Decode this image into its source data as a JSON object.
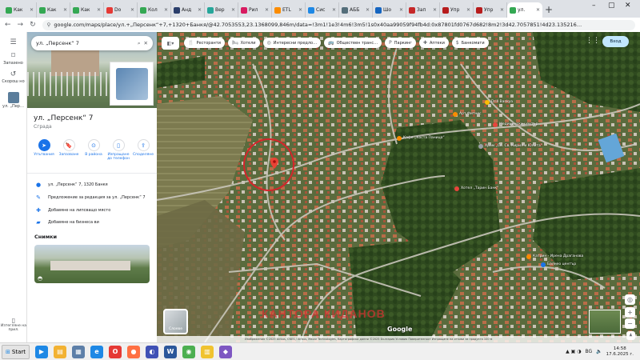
{
  "browser": {
    "tabs": [
      {
        "label": "Как",
        "color": "#34a853"
      },
      {
        "label": "Как",
        "color": "#34a853"
      },
      {
        "label": "Как",
        "color": "#34a853"
      },
      {
        "label": "Do",
        "color": "#e53935"
      },
      {
        "label": "Кол",
        "color": "#34a853"
      },
      {
        "label": "Анд",
        "color": "#2b3e6b"
      },
      {
        "label": "Вер",
        "color": "#26a69a"
      },
      {
        "label": "Рил",
        "color": "#d81b60"
      },
      {
        "label": "ETL",
        "color": "#fb8c00"
      },
      {
        "label": "Сис",
        "color": "#1e88e5"
      },
      {
        "label": "АББ",
        "color": "#546e7a"
      },
      {
        "label": "Шо",
        "color": "#1565c0"
      },
      {
        "label": "Зап",
        "color": "#c62828"
      },
      {
        "label": "Упр",
        "color": "#b71c1c"
      },
      {
        "label": "Упр",
        "color": "#b71c1c"
      }
    ],
    "active_tab": {
      "label": "ул.",
      "color": "#34a853"
    },
    "new_tab": "+",
    "url": "google.com/maps/place/ул.+„Персенк“+7,+1320+Банкя/@42.7053553,23.1368099,846m/data=!3m1!1e3!4m6!3m5!1s0x40aa99059f94fb4d:0x87801fd0767d682!8m2!3d42.7057851!4d23.135216…",
    "window_controls": [
      "–",
      "▢",
      "✕"
    ]
  },
  "rail": {
    "menu_icon": "☰",
    "saved": "Запазено",
    "recent": "Скорош но",
    "current": "ул. „Пер…",
    "bottom": "Изтегляне на прил."
  },
  "panel": {
    "search_value": "ул. „Персенк“ 7",
    "title": "ул. „Персенк“ 7",
    "subtitle": "Сграда",
    "actions": [
      {
        "label": "Упътвания",
        "icon": "➤",
        "primary": true
      },
      {
        "label": "Запазване",
        "icon": "🔖",
        "primary": false
      },
      {
        "label": "В района",
        "icon": "⊙",
        "primary": false
      },
      {
        "label": "Изпращане до телефон",
        "icon": "▯",
        "primary": false
      },
      {
        "label": "Споделяне",
        "icon": "⇪",
        "primary": false
      }
    ],
    "info": [
      {
        "icon": "●",
        "text": "ул. „Персенк“ 7, 1320 Банкя"
      },
      {
        "icon": "✎",
        "text": "Предложение за редакция за ул. „Персенк“ 7"
      },
      {
        "icon": "✚",
        "text": "Добавяне на липсващо място"
      },
      {
        "icon": "▰",
        "text": "Добавяне на бизнеса ви"
      }
    ],
    "photos_label": "Снимки"
  },
  "map": {
    "chips": [
      {
        "icon": "🍴",
        "label": "Ресторанти"
      },
      {
        "icon": "🛏",
        "label": "Хотели"
      },
      {
        "icon": "◎",
        "label": "Интересни предло…"
      },
      {
        "icon": "🚌",
        "label": "Обществен транс…"
      },
      {
        "icon": "P",
        "label": "Паркинг"
      },
      {
        "icon": "✚",
        "label": "Аптеки"
      },
      {
        "icon": "$",
        "label": "Банкомати"
      }
    ],
    "signin": "Вход",
    "pois": [
      {
        "name": "Drill Bankya",
        "color": "#fbbc04"
      },
      {
        "name": "Медицински център",
        "color": "#e8453c"
      },
      {
        "name": "Арт Фитнес",
        "color": "#fb8c00"
      },
      {
        "name": "Кафе „Коста Паница“",
        "color": "#fb8c00"
      },
      {
        "name": "Храм „Св. Св. Кирил и Юлита“",
        "color": "#9aa0a6"
      },
      {
        "name": "Хотел „Тарин Банк“",
        "color": "#e8453c"
      },
      {
        "name": "Катрин - Ирена Драганова",
        "color": "#fb8c00"
      },
      {
        "name": "Балнео център",
        "color": "#1a73e8"
      }
    ],
    "watermark": "КАНТОРА КИДАНОВ",
    "google": "Google",
    "layers_label": "Слоеве",
    "footer": "Изображения ©2025 Airbus, CNES / Airbus, Maxar Technologies, Картографски данни ©2025   България   Условия   Поверителност   Изпращане на отзиви за продукта   100 м"
  },
  "taskbar": {
    "start": "Start",
    "icons": [
      {
        "label": "▶",
        "color": "#1e88e5"
      },
      {
        "label": "▤",
        "color": "#f2b233"
      },
      {
        "label": "▦",
        "color": "#5d7fa8"
      },
      {
        "label": "e",
        "color": "#1e88e5"
      },
      {
        "label": "O",
        "color": "#e53935"
      },
      {
        "label": "●",
        "color": "#ff7043"
      },
      {
        "label": "◐",
        "color": "#3f51b5"
      },
      {
        "label": "W",
        "color": "#2b579a"
      },
      {
        "label": "◉",
        "color": "#4caf50"
      },
      {
        "label": "▥",
        "color": "#f0c330"
      },
      {
        "label": "◆",
        "color": "#7e57c2"
      }
    ],
    "lang": "BG",
    "time": "14:58",
    "date": "17.6.2025 г."
  }
}
